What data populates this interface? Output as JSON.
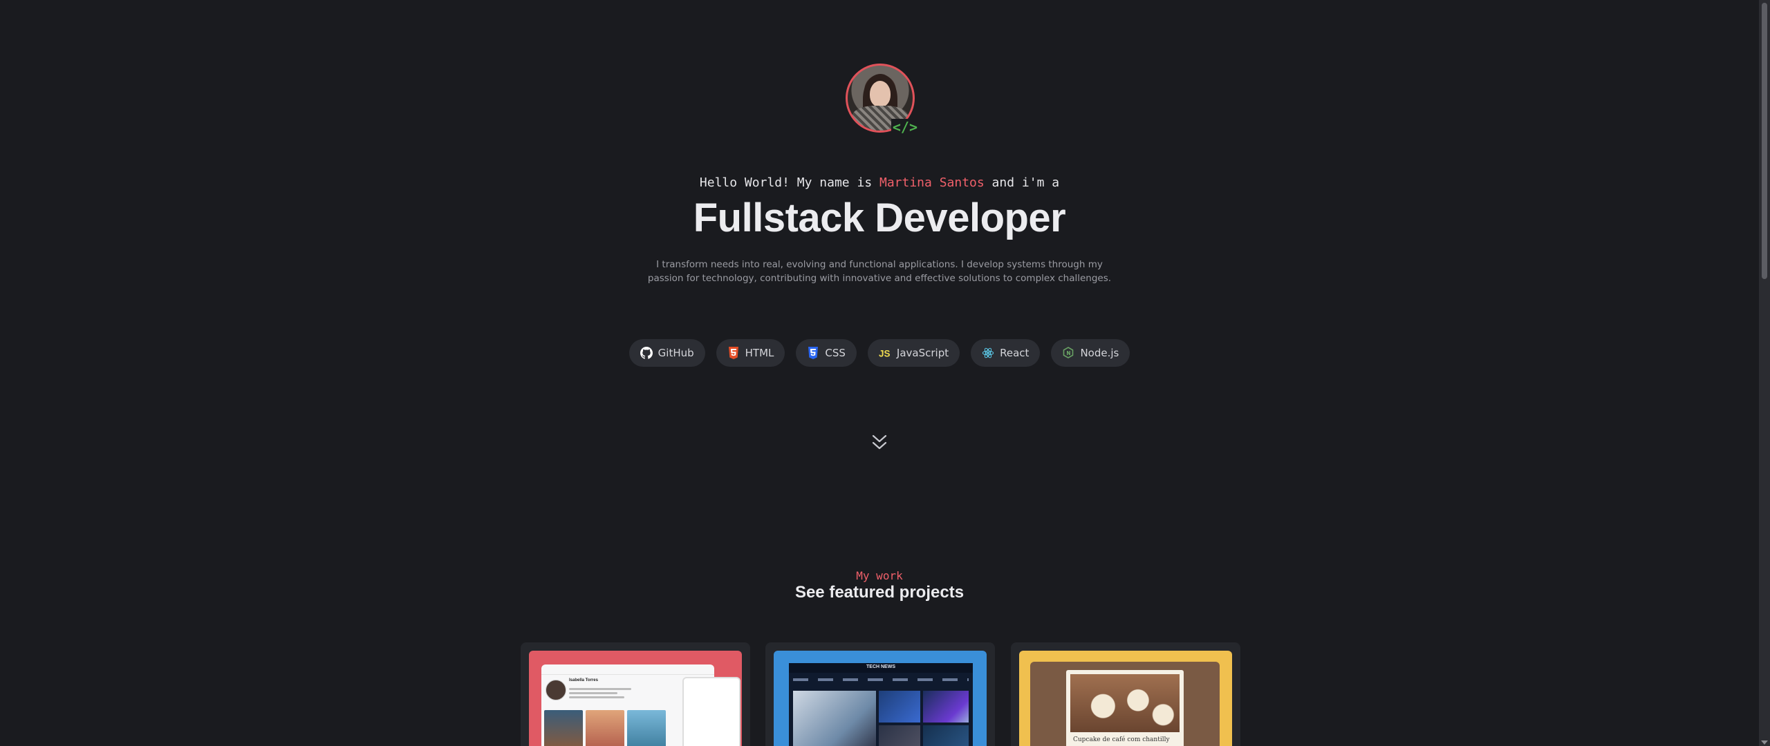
{
  "hero": {
    "avatar_alt": "Martina Santos",
    "code_badge": "</>",
    "intro_prefix": "Hello World! My name is ",
    "name": "Martina Santos",
    "intro_suffix": " and i'm a",
    "headline": "Fullstack Developer",
    "description": "I transform needs into real, evolving and functional applications. I develop systems through my passion for technology, contributing with innovative and effective solutions to complex challenges."
  },
  "tech": [
    {
      "label": "GitHub",
      "icon": "github-icon",
      "color": "#ffffff"
    },
    {
      "label": "HTML",
      "icon": "html5-icon",
      "color": "#e44d26"
    },
    {
      "label": "CSS",
      "icon": "css3-icon",
      "color": "#2965f1"
    },
    {
      "label": "JavaScript",
      "icon": "javascript-icon",
      "color": "#f0db4f"
    },
    {
      "label": "React",
      "icon": "react-icon",
      "color": "#61dafb"
    },
    {
      "label": "Node.js",
      "icon": "nodejs-icon",
      "color": "#68a063"
    }
  ],
  "scroll_down": {
    "icon": "double-chevron-down-icon"
  },
  "work": {
    "kicker": "My work",
    "title": "See featured projects"
  },
  "projects": [
    {
      "accent": "#e05a64",
      "profile_name": "Isabella Torres"
    },
    {
      "accent": "#3a8fd9",
      "site_name": "TECH NEWS"
    },
    {
      "accent": "#f0c04f",
      "caption": "Cupcake de café com chantilly"
    }
  ],
  "colors": {
    "background": "#1a1b1f",
    "accent": "#f0606a",
    "chip_bg": "#2c2e34"
  }
}
